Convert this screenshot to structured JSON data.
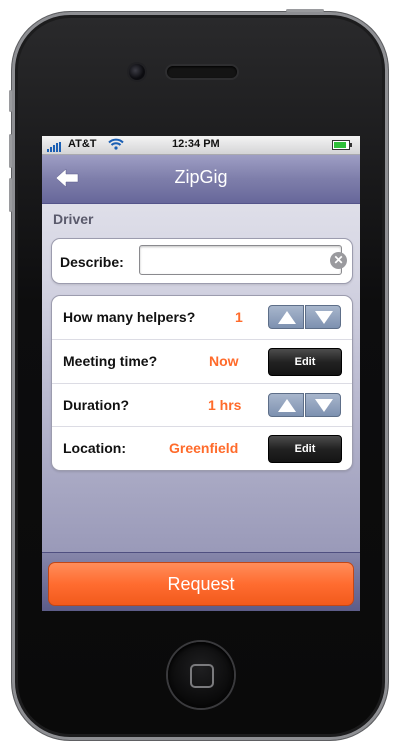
{
  "status_bar": {
    "carrier": "AT&T",
    "time": "12:34 PM"
  },
  "nav": {
    "title": "ZipGig",
    "back_icon": "back-arrow-icon"
  },
  "section": {
    "label": "Driver"
  },
  "describe": {
    "label": "Describe:",
    "value": "",
    "placeholder": ""
  },
  "rows": [
    {
      "label": "How many helpers?",
      "value": "1",
      "control": "stepper"
    },
    {
      "label": "Meeting time?",
      "value": "Now",
      "control": "edit",
      "button_label": "Edit"
    },
    {
      "label": "Duration?",
      "value": "1 hrs",
      "control": "stepper"
    },
    {
      "label": "Location:",
      "value": "Greenfield",
      "control": "edit",
      "button_label": "Edit"
    }
  ],
  "request": {
    "label": "Request"
  },
  "colors": {
    "accent": "#ff6b2b",
    "nav_bar": "#7e7eaa",
    "stepper": "#8a9cb8"
  }
}
